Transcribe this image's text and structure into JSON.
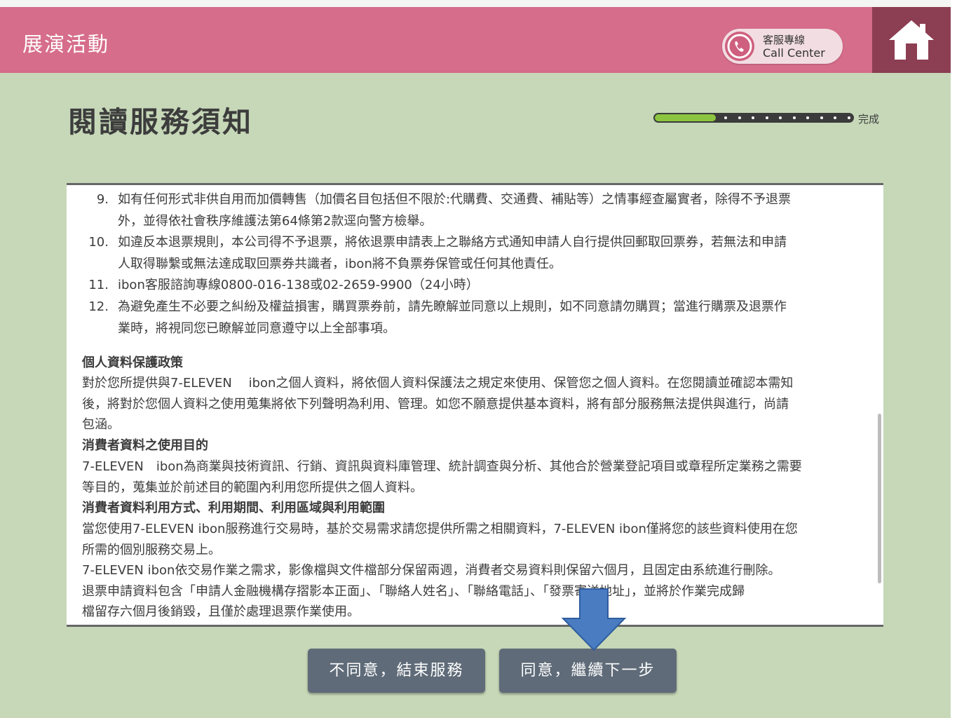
{
  "header": {
    "title": "展演活動",
    "call_center_line1": "客服專線",
    "call_center_line2": "Call Center"
  },
  "page_title": "閱讀服務須知",
  "progress": {
    "label": "完成",
    "fraction": 0.31
  },
  "notice": {
    "items": [
      {
        "num": "9.",
        "lines": [
          "如有任何形式非供自用而加價轉售（加價名目包括但不限於:代購費、交通費、補貼等）之情事經查屬實者，除得不予退票",
          "外，並得依社會秩序維護法第64條第2款逕向警方檢舉。"
        ]
      },
      {
        "num": "10.",
        "lines": [
          "如違反本退票規則，本公司得不予退票，將依退票申請表上之聯絡方式通知申請人自行提供回郵取回票券，若無法和申請",
          "人取得聯繫或無法達成取回票券共識者，ibon將不負票券保管或任何其他責任。"
        ]
      },
      {
        "num": "11.",
        "lines": [
          "ibon客服諮詢專線0800-016-138或02-2659-9900（24小時）"
        ]
      },
      {
        "num": "12.",
        "lines": [
          "為避免產生不必要之糾紛及權益損害，購買票券前，請先瞭解並同意以上規則，如不同意請勿購買；當進行購票及退票作",
          "業時，將視同您已瞭解並同意遵守以上全部事項。"
        ]
      }
    ],
    "privacy_heading": "個人資料保護政策",
    "privacy_lines": [
      "對於您所提供與7-ELEVEN　 ibon之個人資料，將依個人資料保護法之規定來使用、保管您之個人資料。在您閱讀並確認本需知",
      "後，將對於您個人資料之使用蒐集將依下列聲明為利用、管理。如您不願意提供基本資料，將有部分服務無法提供與進行，尚請",
      "包涵。"
    ],
    "purpose_heading": "消費者資料之使用目的",
    "purpose_lines": [
      "7-ELEVEN　ibon為商業與技術資訊、行銷、資訊與資料庫管理、統計調查與分析、其他合於營業登記項目或章程所定業務之需要",
      "等目的，蒐集並於前述目的範圍內利用您所提供之個人資料。"
    ],
    "usage_heading": "消費者資料利用方式、利用期間、利用區域與利用範圍",
    "usage_lines": [
      "當您使用7-ELEVEN ibon服務進行交易時，基於交易需求請您提供所需之相關資料，7-ELEVEN ibon僅將您的該些資料使用在您",
      "所需的個別服務交易上。",
      "7-ELEVEN ibon依交易作業之需求，影像檔與文件檔部分保留兩週，消費者交易資料則保留六個月，且固定由系統進行刪除。",
      "退票申請資料包含「申請人金融機構存摺影本正面」、「聯絡人姓名」、「聯絡電話」、「發票寄送地址」，並將於作業完成歸",
      "檔留存六個月後銷毀，且僅於處理退票作業使用。"
    ]
  },
  "buttons": {
    "disagree": "不同意，結束服務",
    "agree": "同意，繼續下一步"
  },
  "icons": {
    "phone": "phone-icon",
    "home": "home-icon",
    "arrow": "arrow-down-icon"
  },
  "colors": {
    "header": "#d66d8a",
    "home_button": "#8c3e52",
    "background": "#c6d8b8",
    "button": "#5f6b78",
    "progress_fill": "#8cc640",
    "arrow": "#4a7cc2"
  }
}
